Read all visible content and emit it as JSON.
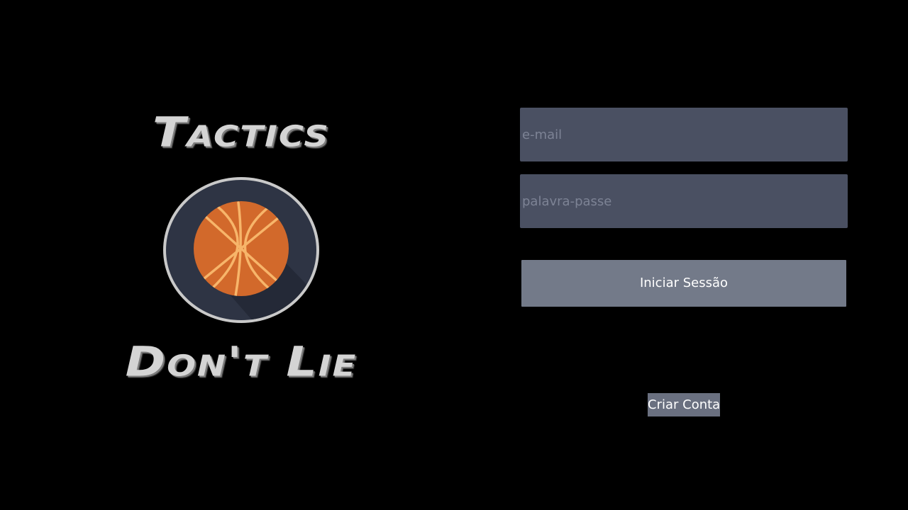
{
  "logo": {
    "title_top": "Tactics",
    "title_bottom": "Don't Lie",
    "emblem_icon": "basketball-icon"
  },
  "login_form": {
    "email_placeholder": "e-mail",
    "email_value": "",
    "password_placeholder": "palavra-passe",
    "password_value": "",
    "submit_label": "Iniciar Sessão",
    "create_account_label": "Criar Conta"
  },
  "colors": {
    "background": "#000000",
    "field_background": "#4a5062",
    "button_background": "#737a89",
    "ball_orange": "#d2692b",
    "ball_lines": "#f7b56a"
  }
}
